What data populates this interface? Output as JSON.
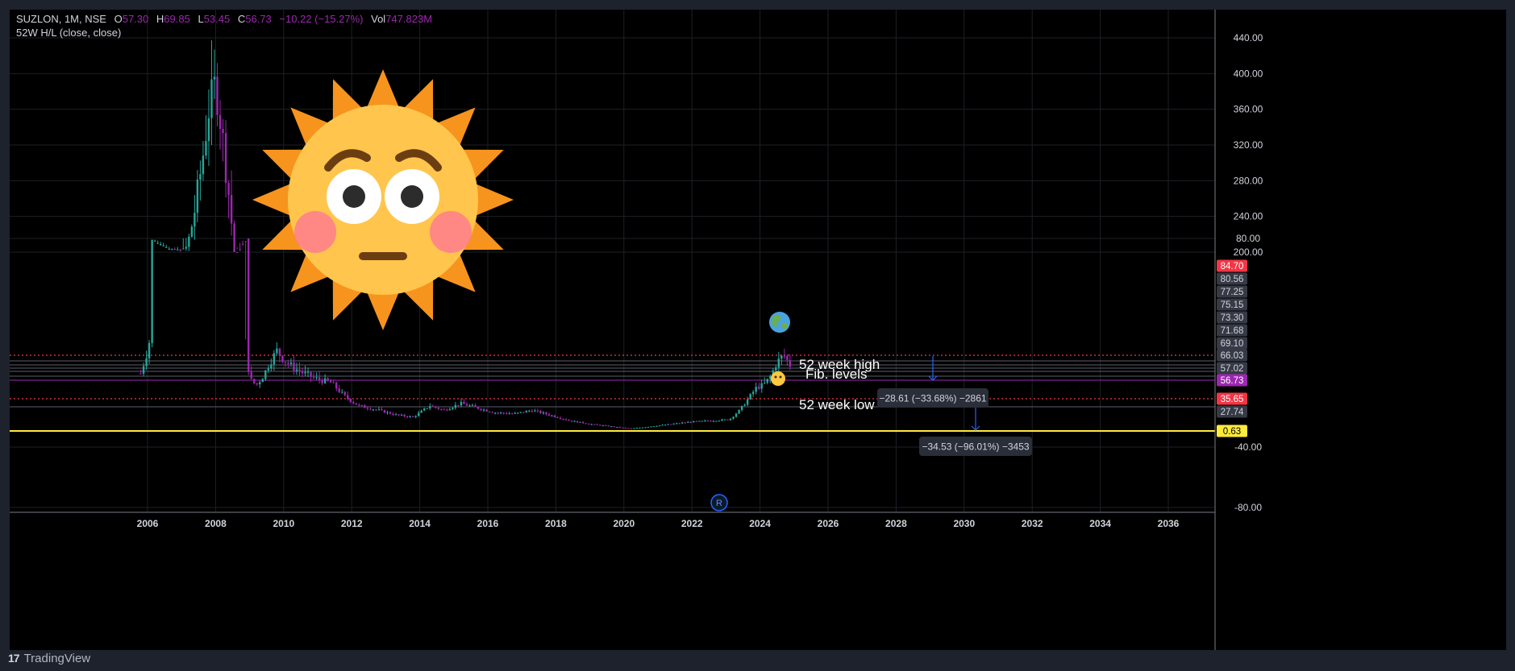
{
  "header": {
    "symbol": "SUZLON, 1M, NSE",
    "open_label": "O",
    "open": "57.30",
    "high_label": "H",
    "high": "69.85",
    "low_label": "L",
    "low": "53.45",
    "close_label": "C",
    "close": "56.73",
    "change": "−10.22 (−15.27%)",
    "vol_label": "Vol",
    "vol": "747.823M",
    "indicator": "52W H/L (close, close)"
  },
  "footer": {
    "brand": "TradingView",
    "logo": "17"
  },
  "colors": {
    "background": "#000000",
    "frame": "#1e222d",
    "up_candle": "#26a69a",
    "down_candle": "#9c27b0",
    "high_line": "#f23645",
    "low_line": "#f23645",
    "zero_line": "#ffeb3b",
    "measure_arrow": "#2962ff",
    "price_badge": "#f23645"
  },
  "annotations": {
    "week_high": "52 week high",
    "fib": "Fib. levels",
    "week_low": "52 week low",
    "measure1": "−28.61 (−33.68%) −2861",
    "measure2": "−34.53 (−96.01%) −3453",
    "r_marker": "R"
  },
  "icons": {
    "sun": "flushed-sun-emoji-icon",
    "globe": "globe-icon"
  },
  "chart_data": {
    "type": "candlestick",
    "symbol": "SUZLON",
    "interval": "1M",
    "exchange": "NSE",
    "x_ticks": [
      "2006",
      "2008",
      "2010",
      "2012",
      "2014",
      "2016",
      "2018",
      "2020",
      "2022",
      "2024",
      "2026",
      "2028",
      "2030",
      "2032",
      "2034",
      "2036"
    ],
    "y_ticks": [
      "440.00",
      "400.00",
      "360.00",
      "320.00",
      "280.00",
      "240.00",
      "200.00",
      "80.00",
      "-40.00",
      "-80.00"
    ],
    "price_badges": [
      {
        "label": "84.70",
        "style": "red"
      },
      {
        "label": "80.56",
        "style": "grey"
      },
      {
        "label": "77.25",
        "style": "grey"
      },
      {
        "label": "75.15",
        "style": "grey"
      },
      {
        "label": "73.30",
        "style": "grey"
      },
      {
        "label": "71.68",
        "style": "grey"
      },
      {
        "label": "69.10",
        "style": "grey"
      },
      {
        "label": "66.03",
        "style": "grey"
      },
      {
        "label": "57.02",
        "style": "grey"
      },
      {
        "label": "56.73",
        "style": "purple"
      },
      {
        "label": "35.65",
        "style": "red"
      },
      {
        "label": "27.74",
        "style": "grey"
      },
      {
        "label": "0.63",
        "style": "yellow"
      }
    ],
    "price_path": [
      [
        2005.8,
        50
      ],
      [
        2006.0,
        70
      ],
      [
        2006.2,
        100
      ],
      [
        2006.4,
        140
      ],
      [
        2006.6,
        170
      ],
      [
        2006.8,
        160
      ],
      [
        2007.0,
        190
      ],
      [
        2007.2,
        210
      ],
      [
        2007.4,
        250
      ],
      [
        2007.6,
        300
      ],
      [
        2007.8,
        360
      ],
      [
        2008.0,
        390
      ],
      [
        2008.2,
        330
      ],
      [
        2008.4,
        260
      ],
      [
        2008.6,
        180
      ],
      [
        2008.8,
        100
      ],
      [
        2009.0,
        45
      ],
      [
        2009.2,
        40
      ],
      [
        2009.4,
        48
      ],
      [
        2009.6,
        60
      ],
      [
        2009.8,
        70
      ],
      [
        2010.0,
        62
      ],
      [
        2010.3,
        55
      ],
      [
        2010.6,
        50
      ],
      [
        2011.0,
        45
      ],
      [
        2011.4,
        42
      ],
      [
        2011.8,
        30
      ],
      [
        2012.2,
        22
      ],
      [
        2012.8,
        18
      ],
      [
        2013.3,
        14
      ],
      [
        2013.8,
        12
      ],
      [
        2014.3,
        22
      ],
      [
        2014.7,
        18
      ],
      [
        2015.2,
        24
      ],
      [
        2015.7,
        20
      ],
      [
        2016.2,
        16
      ],
      [
        2016.8,
        15
      ],
      [
        2017.3,
        18
      ],
      [
        2017.8,
        14
      ],
      [
        2018.4,
        9
      ],
      [
        2019.0,
        6
      ],
      [
        2019.6,
        4
      ],
      [
        2020.2,
        2
      ],
      [
        2020.8,
        4
      ],
      [
        2021.4,
        6
      ],
      [
        2022.0,
        8
      ],
      [
        2022.6,
        9
      ],
      [
        2023.1,
        10
      ],
      [
        2023.4,
        18
      ],
      [
        2023.7,
        30
      ],
      [
        2023.9,
        38
      ],
      [
        2024.1,
        40
      ],
      [
        2024.3,
        47
      ],
      [
        2024.5,
        60
      ],
      [
        2024.7,
        66
      ],
      [
        2024.9,
        56.73
      ]
    ]
  }
}
